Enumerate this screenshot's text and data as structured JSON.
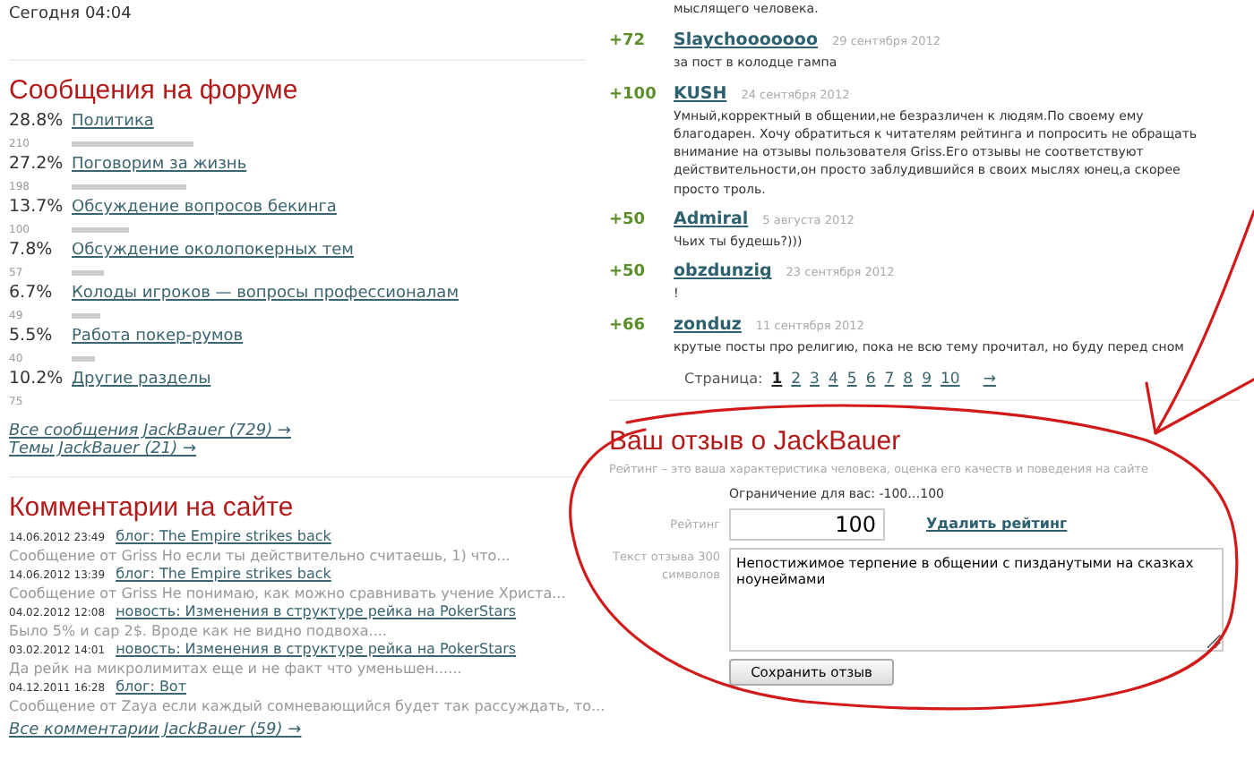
{
  "today": "Сегодня 04:04",
  "forum": {
    "title": "Сообщения на форуме",
    "sections": [
      {
        "percent": "28.8%",
        "name": "Политика",
        "count": "210",
        "bar": true
      },
      {
        "percent": "27.2%",
        "name": "Поговорим за жизнь",
        "count": "198",
        "bar": true
      },
      {
        "percent": "13.7%",
        "name": "Обсуждение вопросов бекинга",
        "count": "100",
        "bar": true
      },
      {
        "percent": "7.8%",
        "name": "Обсуждение околопокерных тем",
        "count": "57",
        "bar": true
      },
      {
        "percent": "6.7%",
        "name": "Колоды игроков — вопросы профессионалам",
        "count": "49",
        "bar": true
      },
      {
        "percent": "5.5%",
        "name": "Работа покер-румов",
        "count": "40",
        "bar": true
      },
      {
        "percent": "10.2%",
        "name": "Другие разделы",
        "count": "75",
        "bar": false
      }
    ],
    "links": [
      "Все сообщения JackBauer (729) →",
      "Темы JackBauer (21) →"
    ]
  },
  "comments": {
    "title": "Комментарии на сайте",
    "items": [
      {
        "date": "14.06.2012 23:49",
        "link": "блог: The Empire strikes back",
        "excerpt": "Сообщение от Griss Но если ты действительно считаешь, 1) что..."
      },
      {
        "date": "14.06.2012 13:39",
        "link": "блог: The Empire strikes back",
        "excerpt": "Сообщение от Griss Не понимаю, как можно сравнивать учение Христа..."
      },
      {
        "date": "04.02.2012 12:08",
        "link": "новость: Изменения в структуре рейка на PokerStars",
        "excerpt": "Было 5% и cap 2$. Вроде как не видно подвоха...."
      },
      {
        "date": "03.02.2012 14:01",
        "link": "новость: Изменения в структуре рейка на PokerStars",
        "excerpt": "Да рейк на микролимитах еще и не факт что уменьшен......"
      },
      {
        "date": "04.12.2011 16:28",
        "link": "блог: Вот",
        "excerpt": "Сообщение от Zaya если каждый сомневающийся будет так рассуждать, то..."
      }
    ],
    "all_link": "Все комментарии JackBauer (59) →"
  },
  "reviews": {
    "cut_text": "мыслящего человека.",
    "items": [
      {
        "score": "+72",
        "author": "Slaychooooooo",
        "date": "29 сентября 2012",
        "text": "за пост в колодце гампа"
      },
      {
        "score": "+100",
        "author": "KUSH",
        "date": "24 сентября 2012",
        "text": "Умный,корректный в общении,не безразличен к людям.По своему ему благодарен. Хочу обратиться к читателям рейтинга и попросить не обращать внимание на отзывы пользователя Griss.Его отзывы не соответствуют действительности,он просто заблудившийся в своих мыслях юнец,а скорее просто троль."
      },
      {
        "score": "+50",
        "author": "Admiral",
        "date": "5 августа 2012",
        "text": "Чьих ты будешь?)))"
      },
      {
        "score": "+50",
        "author": "obzdunzig",
        "date": "23 сентября 2012",
        "text": "!"
      },
      {
        "score": "+66",
        "author": "zonduz",
        "date": "11 сентября 2012",
        "text": "крутые посты про религию, пока не всю тему прочитал, но буду перед сном"
      }
    ],
    "pager": {
      "label": "Страница:",
      "pages": [
        {
          "label": "1",
          "selected": true
        },
        {
          "label": "2",
          "selected": false
        },
        {
          "label": "3",
          "selected": false
        },
        {
          "label": "4",
          "selected": false
        },
        {
          "label": "5",
          "selected": false
        },
        {
          "label": "6",
          "selected": false
        },
        {
          "label": "7",
          "selected": false
        },
        {
          "label": "8",
          "selected": false
        },
        {
          "label": "9",
          "selected": false
        },
        {
          "label": "10",
          "selected": false
        }
      ],
      "next": "→"
    }
  },
  "form": {
    "title": "Ваш отзыв о JackBauer",
    "subtitle": "Рейтинг – это ваша характеристика человека, оценка его качеств и поведения на сайте",
    "limit": "Ограничение для вас: -100…100",
    "rating_label": "Рейтинг",
    "rating_value": "100",
    "delete_link": "Удалить рейтинг",
    "text_label": "Текст отзыва 300 символов",
    "text_value": "Непостижимое терпение в общении с пизданутыми на сказках ноунеймами",
    "submit": "Сохранить отзыв"
  }
}
